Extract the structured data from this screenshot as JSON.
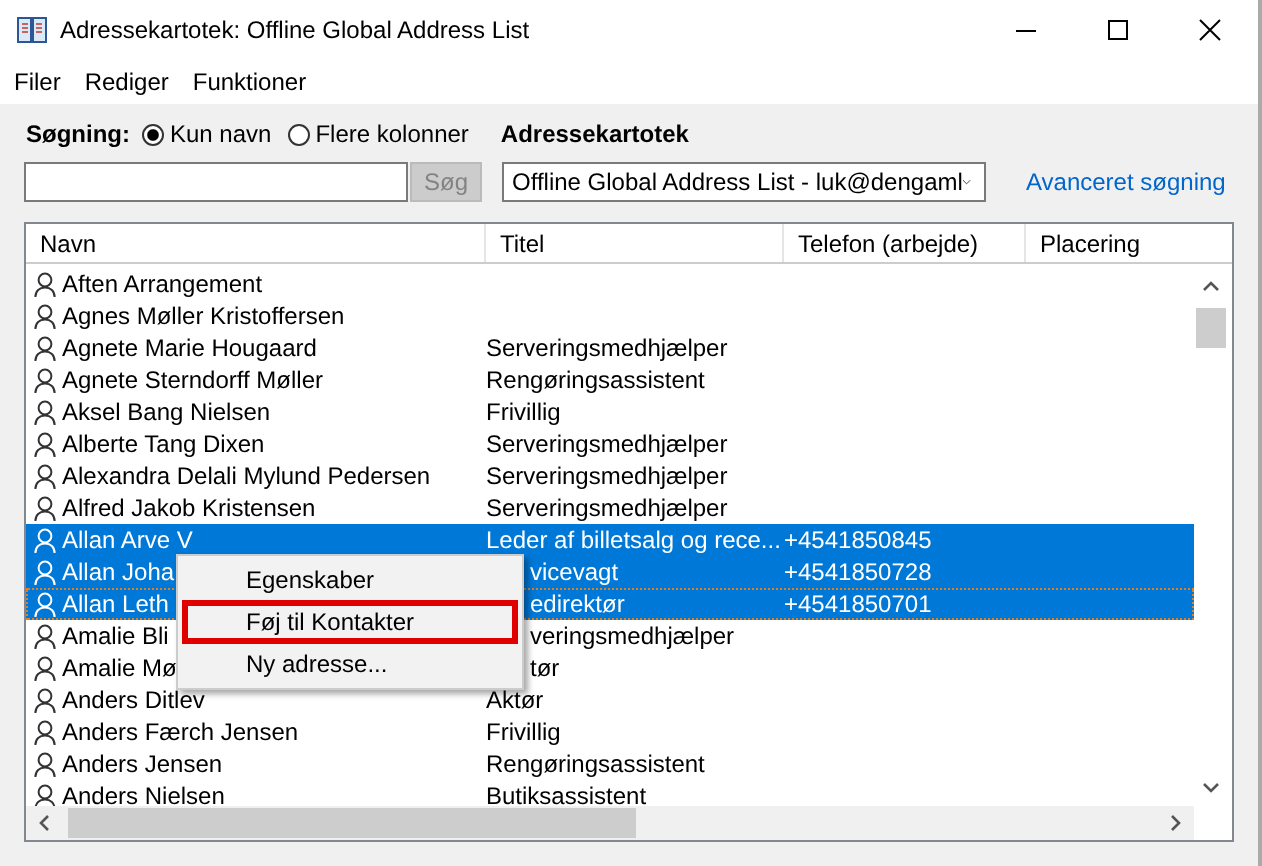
{
  "window": {
    "title": "Adressekartotek: Offline Global Address List"
  },
  "menu": [
    "Filer",
    "Rediger",
    "Funktioner"
  ],
  "search": {
    "label": "Søgning:",
    "options": [
      {
        "label": "Kun navn",
        "selected": true
      },
      {
        "label": "Flere kolonner",
        "selected": false
      }
    ],
    "button": {
      "label": "Søg",
      "disabled": true
    }
  },
  "address_book": {
    "label": "Adressekartotek",
    "value": "Offline Global Address List - luk@dengaml",
    "advanced_link": "Avanceret søgning"
  },
  "table": {
    "columns": [
      "Navn",
      "Titel",
      "Telefon (arbejde)",
      "Placering"
    ],
    "rows": [
      {
        "name": "Aften Arrangement",
        "title": "",
        "phone": "",
        "selected": false
      },
      {
        "name": "Agnes Møller Kristoffersen",
        "title": "",
        "phone": "",
        "selected": false
      },
      {
        "name": "Agnete Marie Hougaard",
        "title": "Serveringsmedhjælper",
        "phone": "",
        "selected": false
      },
      {
        "name": "Agnete Sterndorff Møller",
        "title": "Rengøringsassistent",
        "phone": "",
        "selected": false
      },
      {
        "name": "Aksel Bang Nielsen",
        "title": "Frivillig",
        "phone": "",
        "selected": false
      },
      {
        "name": "Alberte Tang Dixen",
        "title": "Serveringsmedhjælper",
        "phone": "",
        "selected": false
      },
      {
        "name": "Alexandra Delali Mylund Pedersen",
        "title": "Serveringsmedhjælper",
        "phone": "",
        "selected": false
      },
      {
        "name": "Alfred Jakob Kristensen",
        "title": "Serveringsmedhjælper",
        "phone": "",
        "selected": false
      },
      {
        "name": "Allan Arve V",
        "title": "Leder af billetsalg og rece...",
        "phone": "+4541850845",
        "selected": true,
        "focused": false
      },
      {
        "name": "Allan Joha",
        "title": "vicevagt",
        "phone": "+4541850728",
        "selected": true,
        "focused": false,
        "title_covered": true
      },
      {
        "name": "Allan Leth",
        "title": "edirektør",
        "phone": "+4541850701",
        "selected": true,
        "focused": true,
        "title_covered": true
      },
      {
        "name": "Amalie Bli",
        "title": "veringsmedhjælper",
        "phone": "",
        "selected": false,
        "title_covered": true
      },
      {
        "name": "Amalie Mø",
        "title": "tør",
        "phone": "",
        "selected": false,
        "title_covered": true
      },
      {
        "name": "Anders Ditlev",
        "title": "Aktør",
        "phone": "",
        "selected": false
      },
      {
        "name": "Anders Færch Jensen",
        "title": "Frivillig",
        "phone": "",
        "selected": false
      },
      {
        "name": "Anders Jensen",
        "title": "Rengøringsassistent",
        "phone": "",
        "selected": false
      },
      {
        "name": "Anders Nielsen",
        "title": "Butiksassistent",
        "phone": "",
        "selected": false
      }
    ]
  },
  "context_menu": {
    "items": [
      {
        "label": "Egenskaber",
        "highlighted": false
      },
      {
        "label": "Føj til Kontakter",
        "highlighted": true
      },
      {
        "label": "Ny adresse...",
        "highlighted": false
      }
    ]
  }
}
